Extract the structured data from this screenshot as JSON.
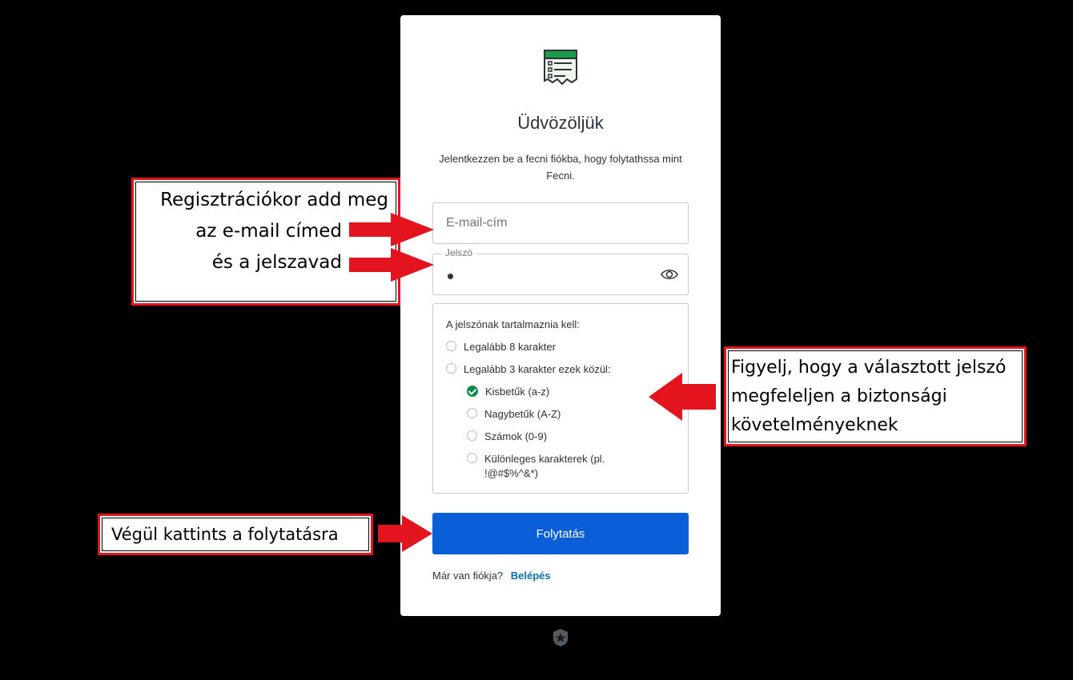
{
  "card": {
    "title": "Üdvözöljük",
    "subtitle": "Jelentkezzen be a fecni fiókba, hogy folytathssa mint Fecni.",
    "email_placeholder": "E-mail-cím",
    "password_label": "Jelszó",
    "password_icon": "eye-icon",
    "rules": {
      "heading": "A jelszónak tartalmaznia kell:",
      "items": [
        {
          "label": "Legalább 8 karakter",
          "met": false
        },
        {
          "label": "Legalább 3 karakter ezek közül:",
          "met": false
        },
        {
          "label": "Kisbetűk (a-z)",
          "met": true
        },
        {
          "label": "Nagybetűk (A-Z)",
          "met": false
        },
        {
          "label": "Számok (0-9)",
          "met": false
        },
        {
          "label": "Különleges karakterek (pl. !@#$%^&*)",
          "met": false
        }
      ]
    },
    "continue_label": "Folytatás",
    "login_prompt": "Már van fiókja?",
    "login_link": "Belépés"
  },
  "annotations": {
    "email_password": [
      "Regisztrációkor add meg",
      "az e-mail címed",
      "és a jelszavad"
    ],
    "requirements": [
      "Figyelj, hogy a választott jelszó",
      "megfeleljen a biztonsági",
      "követelményeknek"
    ],
    "continue": "Végül kattints a folytatásra"
  },
  "colors": {
    "background": "#000000",
    "primary_button": "#0a5ed7",
    "check_green": "#0d8b52",
    "callout_red": "#e3141d",
    "logo_green": "#1a9c47"
  }
}
